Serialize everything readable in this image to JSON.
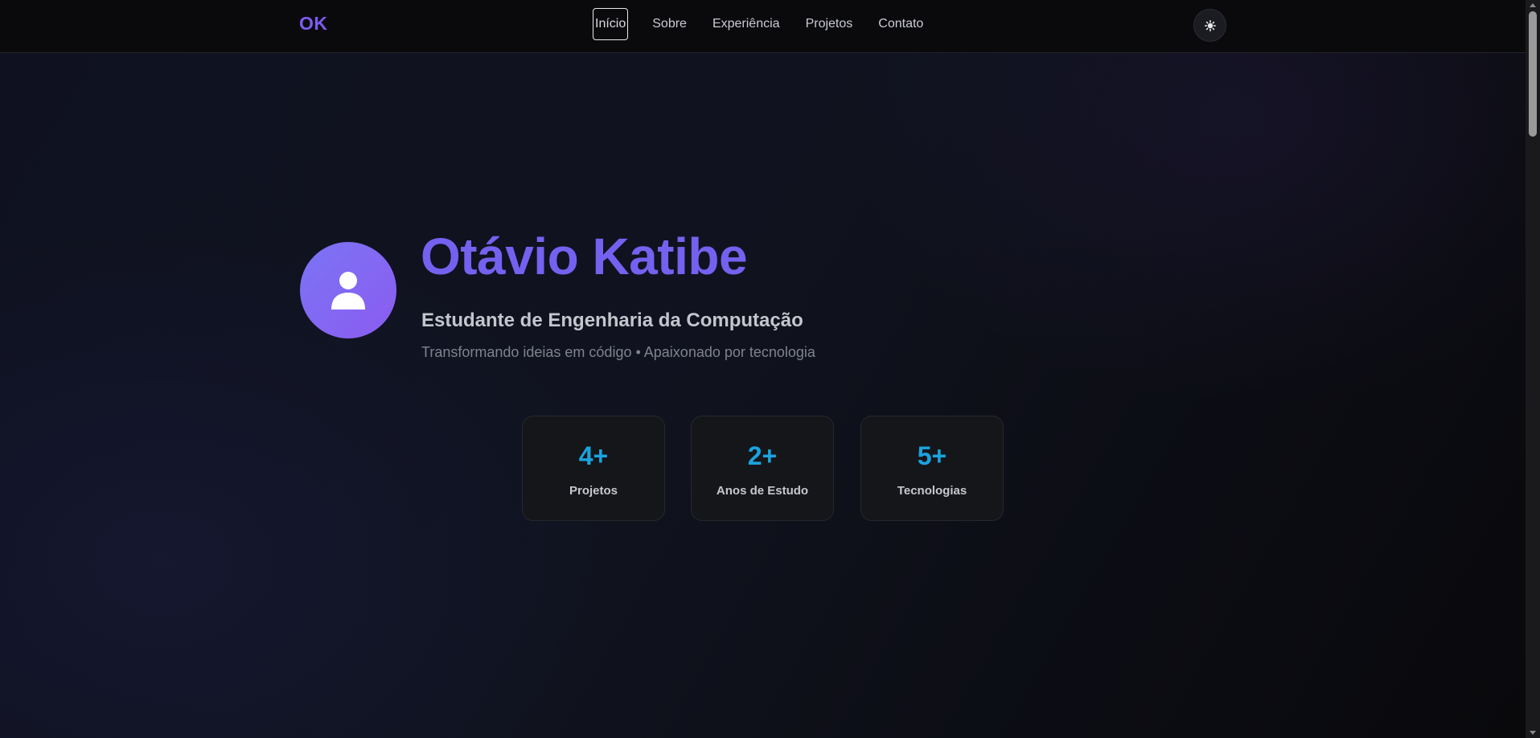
{
  "brand": {
    "logo_text": "OK"
  },
  "nav": {
    "items": [
      {
        "label": "Início",
        "active": true
      },
      {
        "label": "Sobre",
        "active": false
      },
      {
        "label": "Experiência",
        "active": false
      },
      {
        "label": "Projetos",
        "active": false
      },
      {
        "label": "Contato",
        "active": false
      }
    ],
    "theme_toggle_icon": "sun-gear-icon"
  },
  "hero": {
    "avatar_icon": "user-icon",
    "name": "Otávio Katibe",
    "subtitle": "Estudante de Engenharia da Computação",
    "tagline": "Transformando ideias em código • Apaixonado por tecnologia"
  },
  "stats": [
    {
      "value": "4+",
      "label": "Projetos"
    },
    {
      "value": "2+",
      "label": "Anos de Estudo"
    },
    {
      "value": "5+",
      "label": "Tecnologias"
    }
  ],
  "colors": {
    "accent_purple": "#7561ef",
    "accent_blue": "#1aa3df",
    "background": "#0b0d12"
  }
}
